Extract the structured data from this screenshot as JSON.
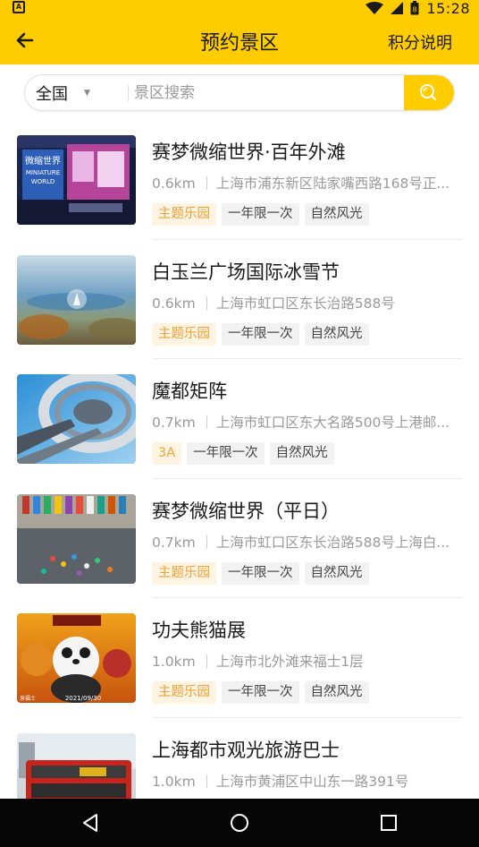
{
  "status_bar": {
    "app_badge": "A",
    "battery_text": "8",
    "time": "15:28"
  },
  "header": {
    "back_icon": "arrow-left-icon",
    "title": "预约景区",
    "rules_link": "积分说明"
  },
  "search": {
    "region": "全国",
    "placeholder": "景区搜索",
    "value": "",
    "button_icon": "search-icon"
  },
  "colors": {
    "brand_yellow": "#ffcc00",
    "tag_highlight_text": "#e9a23b",
    "tag_highlight_bg": "#fff3e2"
  },
  "scenic_list": [
    {
      "name": "赛梦微缩世界·百年外滩",
      "distance": "0.6km",
      "address": "上海市浦东新区陆家嘴西路168号正...",
      "tags": [
        "主题乐园",
        "一年限一次",
        "自然风光"
      ]
    },
    {
      "name": "白玉兰广场国际冰雪节",
      "distance": "0.6km",
      "address": "上海市虹口区东长治路588号",
      "tags": [
        "主题乐园",
        "一年限一次",
        "自然风光"
      ]
    },
    {
      "name": "魔都矩阵",
      "distance": "0.7km",
      "address": "上海市虹口区东大名路500号上港邮...",
      "tags": [
        "3A",
        "一年限一次",
        "自然风光"
      ]
    },
    {
      "name": "赛梦微缩世界（平日）",
      "distance": "0.7km",
      "address": "上海市虹口区东长治路588号上海白...",
      "tags": [
        "主题乐园",
        "一年限一次",
        "自然风光"
      ]
    },
    {
      "name": "功夫熊猫展",
      "distance": "1.0km",
      "address": "上海市北外滩来福士1层",
      "tags": [
        "主题乐园",
        "一年限一次",
        "自然风光"
      ]
    },
    {
      "name": "上海都市观光旅游巴士",
      "distance": "1.0km",
      "address": "上海市黄浦区中山东一路391号",
      "tags": []
    }
  ],
  "thumb_overlay": {
    "item0_sign_1": "微缩世界",
    "item0_sign_2": "MINIATURE",
    "item0_sign_3": "WORLD",
    "item4_date": "2021/09/30",
    "item4_corner": "来福士"
  },
  "nav_bar": {
    "back": "nav-back-icon",
    "home": "nav-home-icon",
    "recents": "nav-recents-icon"
  }
}
